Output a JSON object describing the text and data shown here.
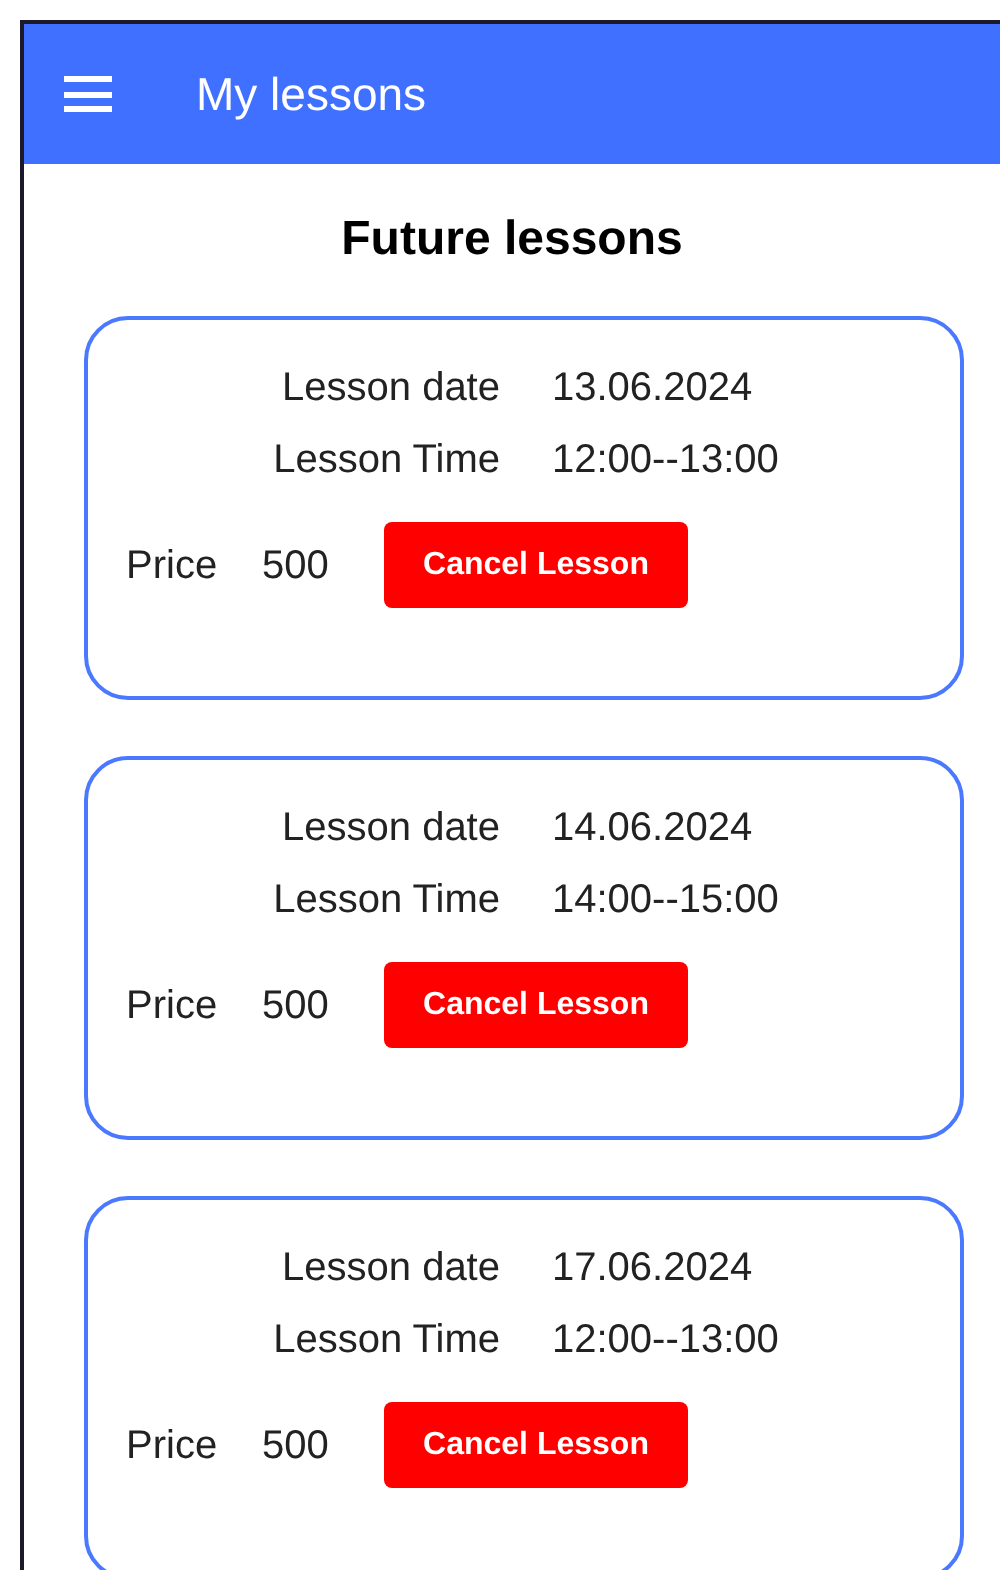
{
  "app_bar": {
    "title": "My lessons"
  },
  "heading": "Future lessons",
  "lessons": [
    {
      "date_label": "Lesson date",
      "date": "13.06.2024",
      "time_label": "Lesson Time",
      "time": "12:00--13:00",
      "price_label": "Price",
      "price": "500",
      "button": "Cancel Lesson"
    },
    {
      "date_label": "Lesson date",
      "date": "14.06.2024",
      "time_label": "Lesson Time",
      "time": "14:00--15:00",
      "price_label": "Price",
      "price": "500",
      "button": "Cancel Lesson"
    },
    {
      "date_label": "Lesson date",
      "date": "17.06.2024",
      "time_label": "Lesson Time",
      "time": "12:00--13:00",
      "price_label": "Price",
      "price": "500",
      "button": "Cancel Lesson"
    }
  ]
}
